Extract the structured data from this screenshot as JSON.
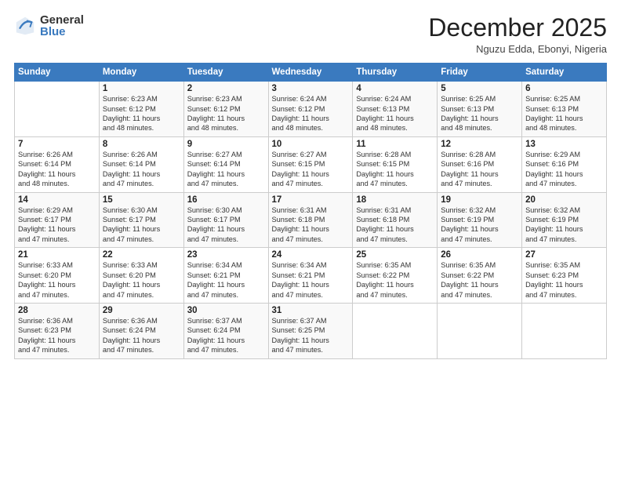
{
  "logo": {
    "general": "General",
    "blue": "Blue"
  },
  "header": {
    "month": "December 2025",
    "location": "Nguzu Edda, Ebonyi, Nigeria"
  },
  "weekdays": [
    "Sunday",
    "Monday",
    "Tuesday",
    "Wednesday",
    "Thursday",
    "Friday",
    "Saturday"
  ],
  "weeks": [
    [
      {
        "day": "",
        "info": ""
      },
      {
        "day": "1",
        "info": "Sunrise: 6:23 AM\nSunset: 6:12 PM\nDaylight: 11 hours\nand 48 minutes."
      },
      {
        "day": "2",
        "info": "Sunrise: 6:23 AM\nSunset: 6:12 PM\nDaylight: 11 hours\nand 48 minutes."
      },
      {
        "day": "3",
        "info": "Sunrise: 6:24 AM\nSunset: 6:12 PM\nDaylight: 11 hours\nand 48 minutes."
      },
      {
        "day": "4",
        "info": "Sunrise: 6:24 AM\nSunset: 6:13 PM\nDaylight: 11 hours\nand 48 minutes."
      },
      {
        "day": "5",
        "info": "Sunrise: 6:25 AM\nSunset: 6:13 PM\nDaylight: 11 hours\nand 48 minutes."
      },
      {
        "day": "6",
        "info": "Sunrise: 6:25 AM\nSunset: 6:13 PM\nDaylight: 11 hours\nand 48 minutes."
      }
    ],
    [
      {
        "day": "7",
        "info": "Sunrise: 6:26 AM\nSunset: 6:14 PM\nDaylight: 11 hours\nand 48 minutes."
      },
      {
        "day": "8",
        "info": "Sunrise: 6:26 AM\nSunset: 6:14 PM\nDaylight: 11 hours\nand 47 minutes."
      },
      {
        "day": "9",
        "info": "Sunrise: 6:27 AM\nSunset: 6:14 PM\nDaylight: 11 hours\nand 47 minutes."
      },
      {
        "day": "10",
        "info": "Sunrise: 6:27 AM\nSunset: 6:15 PM\nDaylight: 11 hours\nand 47 minutes."
      },
      {
        "day": "11",
        "info": "Sunrise: 6:28 AM\nSunset: 6:15 PM\nDaylight: 11 hours\nand 47 minutes."
      },
      {
        "day": "12",
        "info": "Sunrise: 6:28 AM\nSunset: 6:16 PM\nDaylight: 11 hours\nand 47 minutes."
      },
      {
        "day": "13",
        "info": "Sunrise: 6:29 AM\nSunset: 6:16 PM\nDaylight: 11 hours\nand 47 minutes."
      }
    ],
    [
      {
        "day": "14",
        "info": "Sunrise: 6:29 AM\nSunset: 6:17 PM\nDaylight: 11 hours\nand 47 minutes."
      },
      {
        "day": "15",
        "info": "Sunrise: 6:30 AM\nSunset: 6:17 PM\nDaylight: 11 hours\nand 47 minutes."
      },
      {
        "day": "16",
        "info": "Sunrise: 6:30 AM\nSunset: 6:17 PM\nDaylight: 11 hours\nand 47 minutes."
      },
      {
        "day": "17",
        "info": "Sunrise: 6:31 AM\nSunset: 6:18 PM\nDaylight: 11 hours\nand 47 minutes."
      },
      {
        "day": "18",
        "info": "Sunrise: 6:31 AM\nSunset: 6:18 PM\nDaylight: 11 hours\nand 47 minutes."
      },
      {
        "day": "19",
        "info": "Sunrise: 6:32 AM\nSunset: 6:19 PM\nDaylight: 11 hours\nand 47 minutes."
      },
      {
        "day": "20",
        "info": "Sunrise: 6:32 AM\nSunset: 6:19 PM\nDaylight: 11 hours\nand 47 minutes."
      }
    ],
    [
      {
        "day": "21",
        "info": "Sunrise: 6:33 AM\nSunset: 6:20 PM\nDaylight: 11 hours\nand 47 minutes."
      },
      {
        "day": "22",
        "info": "Sunrise: 6:33 AM\nSunset: 6:20 PM\nDaylight: 11 hours\nand 47 minutes."
      },
      {
        "day": "23",
        "info": "Sunrise: 6:34 AM\nSunset: 6:21 PM\nDaylight: 11 hours\nand 47 minutes."
      },
      {
        "day": "24",
        "info": "Sunrise: 6:34 AM\nSunset: 6:21 PM\nDaylight: 11 hours\nand 47 minutes."
      },
      {
        "day": "25",
        "info": "Sunrise: 6:35 AM\nSunset: 6:22 PM\nDaylight: 11 hours\nand 47 minutes."
      },
      {
        "day": "26",
        "info": "Sunrise: 6:35 AM\nSunset: 6:22 PM\nDaylight: 11 hours\nand 47 minutes."
      },
      {
        "day": "27",
        "info": "Sunrise: 6:35 AM\nSunset: 6:23 PM\nDaylight: 11 hours\nand 47 minutes."
      }
    ],
    [
      {
        "day": "28",
        "info": "Sunrise: 6:36 AM\nSunset: 6:23 PM\nDaylight: 11 hours\nand 47 minutes."
      },
      {
        "day": "29",
        "info": "Sunrise: 6:36 AM\nSunset: 6:24 PM\nDaylight: 11 hours\nand 47 minutes."
      },
      {
        "day": "30",
        "info": "Sunrise: 6:37 AM\nSunset: 6:24 PM\nDaylight: 11 hours\nand 47 minutes."
      },
      {
        "day": "31",
        "info": "Sunrise: 6:37 AM\nSunset: 6:25 PM\nDaylight: 11 hours\nand 47 minutes."
      },
      {
        "day": "",
        "info": ""
      },
      {
        "day": "",
        "info": ""
      },
      {
        "day": "",
        "info": ""
      }
    ]
  ]
}
